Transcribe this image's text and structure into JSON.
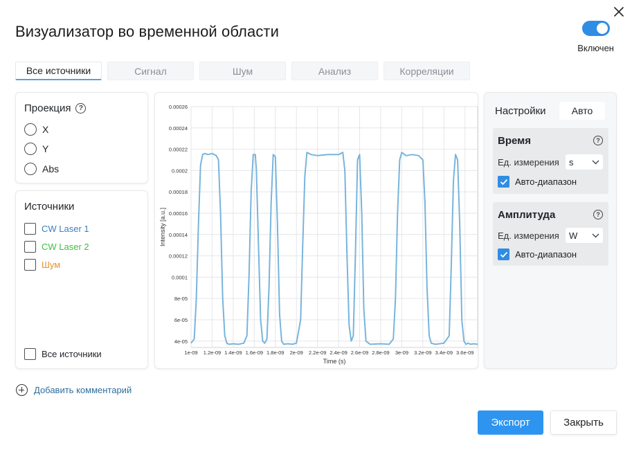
{
  "dialog": {
    "title": "Визуализатор во временной области",
    "toggle_label": "Включен",
    "toggle_on": true
  },
  "tabs": [
    {
      "label": "Все источники",
      "active": true
    },
    {
      "label": "Сигнал",
      "active": false
    },
    {
      "label": "Шум",
      "active": false
    },
    {
      "label": "Анализ",
      "active": false
    },
    {
      "label": "Корреляции",
      "active": false
    }
  ],
  "projection": {
    "title": "Проекция",
    "options": [
      "X",
      "Y",
      "Abs"
    ]
  },
  "sources": {
    "title": "Источники",
    "items": [
      {
        "label": "CW Laser 1",
        "color": "#3a7fc1"
      },
      {
        "label": "CW Laser 2",
        "color": "#3fbf3f"
      },
      {
        "label": "Шум",
        "color": "#e7952b"
      }
    ],
    "all_label": "Все источники"
  },
  "settings": {
    "title": "Настройки",
    "auto_button": "Авто",
    "time": {
      "title": "Время",
      "unit_label": "Ед. измерения",
      "unit_value": "s",
      "auto_range_label": "Авто-диапазон",
      "auto_range": true
    },
    "amplitude": {
      "title": "Амплитуда",
      "unit_label": "Ед. измерения",
      "unit_value": "W",
      "auto_range_label": "Авто-диапазон",
      "auto_range": true
    }
  },
  "footer": {
    "add_comment": "Добавить комментарий",
    "export": "Экспорт",
    "close": "Закрыть"
  },
  "chart_data": {
    "type": "line",
    "xlabel": "Time (s)",
    "ylabel": "Intensity [a.u.]",
    "xlim": [
      1e-09,
      3.72e-09
    ],
    "ylim": [
      3.4e-05,
      0.00026
    ],
    "grid": true,
    "x_ticks": [
      "1e-09",
      "1.2e-09",
      "1.4e-09",
      "1.6e-09",
      "1.8e-09",
      "2e-09",
      "2.2e-09",
      "2.4e-09",
      "2.6e-09",
      "2.8e-09",
      "3e-09",
      "3.2e-09",
      "3.4e-09",
      "3.6e-09"
    ],
    "x_tick_values": [
      1e-09,
      1.2e-09,
      1.4e-09,
      1.6e-09,
      1.8e-09,
      2e-09,
      2.2e-09,
      2.4e-09,
      2.6e-09,
      2.8e-09,
      3e-09,
      3.2e-09,
      3.4e-09,
      3.6e-09
    ],
    "y_ticks": [
      "0.00026",
      "0.00024",
      "0.00022",
      "0.0002",
      "0.00018",
      "0.00016",
      "0.00014",
      "0.00012",
      "0.0001",
      "8e-05",
      "6e-05",
      "4e-05"
    ],
    "y_tick_values": [
      0.00026,
      0.00024,
      0.00022,
      0.0002,
      0.00018,
      0.00016,
      0.00014,
      0.00012,
      0.0001,
      8e-05,
      6e-05,
      4e-05
    ],
    "series": [
      {
        "color": "#78b4dc",
        "x": [
          1e-09,
          1.03e-09,
          1.05e-09,
          1.07e-09,
          1.09e-09,
          1.11e-09,
          1.13e-09,
          1.16e-09,
          1.2e-09,
          1.24e-09,
          1.26e-09,
          1.28e-09,
          1.3e-09,
          1.32e-09,
          1.34e-09,
          1.36e-09,
          1.4e-09,
          1.45e-09,
          1.5e-09,
          1.53e-09,
          1.55e-09,
          1.57e-09,
          1.59e-09,
          1.61e-09,
          1.62e-09,
          1.64e-09,
          1.66e-09,
          1.68e-09,
          1.7e-09,
          1.72e-09,
          1.74e-09,
          1.76e-09,
          1.78e-09,
          1.8e-09,
          1.82e-09,
          1.84e-09,
          1.86e-09,
          1.88e-09,
          1.92e-09,
          1.96e-09,
          2e-09,
          2.04e-09,
          2.06e-09,
          2.08e-09,
          2.1e-09,
          2.14e-09,
          2.2e-09,
          2.3e-09,
          2.4e-09,
          2.44e-09,
          2.46e-09,
          2.48e-09,
          2.5e-09,
          2.52e-09,
          2.54e-09,
          2.56e-09,
          2.58e-09,
          2.6e-09,
          2.62e-09,
          2.64e-09,
          2.66e-09,
          2.7e-09,
          2.8e-09,
          2.88e-09,
          2.92e-09,
          2.94e-09,
          2.96e-09,
          2.98e-09,
          3e-09,
          3.04e-09,
          3.1e-09,
          3.16e-09,
          3.2e-09,
          3.22e-09,
          3.24e-09,
          3.26e-09,
          3.28e-09,
          3.32e-09,
          3.4e-09,
          3.45e-09,
          3.47e-09,
          3.49e-09,
          3.51e-09,
          3.53e-09,
          3.55e-09,
          3.57e-09,
          3.59e-09,
          3.61e-09,
          3.63e-09,
          3.65e-09,
          3.68e-09,
          3.72e-09
        ],
        "y": [
          3.8e-05,
          4.2e-05,
          8e-05,
          0.00015,
          0.000205,
          0.000215,
          0.000216,
          0.000215,
          0.000216,
          0.000214,
          0.00021,
          0.00016,
          8e-05,
          4.5e-05,
          3.8e-05,
          3.7e-05,
          3.75e-05,
          3.7e-05,
          3.8e-05,
          4.5e-05,
          0.0001,
          0.00018,
          0.000215,
          0.000215,
          0.0002,
          0.00013,
          6e-05,
          4e-05,
          3.8e-05,
          4.2e-05,
          9e-05,
          0.00017,
          0.000215,
          0.000213,
          0.00015,
          6.5e-05,
          4e-05,
          3.7e-05,
          3.75e-05,
          3.7e-05,
          3.8e-05,
          6e-05,
          0.00013,
          0.000195,
          0.000217,
          0.000215,
          0.000214,
          0.000215,
          0.000215,
          0.000217,
          0.0002,
          0.00012,
          5.5e-05,
          4e-05,
          4.5e-05,
          0.00012,
          0.00021,
          0.000215,
          0.00016,
          7e-05,
          4e-05,
          3.7e-05,
          3.75e-05,
          3.7e-05,
          4.2e-05,
          8e-05,
          0.00016,
          0.00021,
          0.000217,
          0.000214,
          0.000215,
          0.000214,
          0.00021,
          0.00017,
          9e-05,
          4.5e-05,
          3.8e-05,
          3.7e-05,
          3.8e-05,
          4.5e-05,
          0.00011,
          0.00019,
          0.000215,
          0.00021,
          0.00015,
          6e-05,
          4e-05,
          3.7e-05,
          3.8e-05,
          3.7e-05,
          3.75e-05,
          3.7e-05
        ]
      }
    ]
  }
}
